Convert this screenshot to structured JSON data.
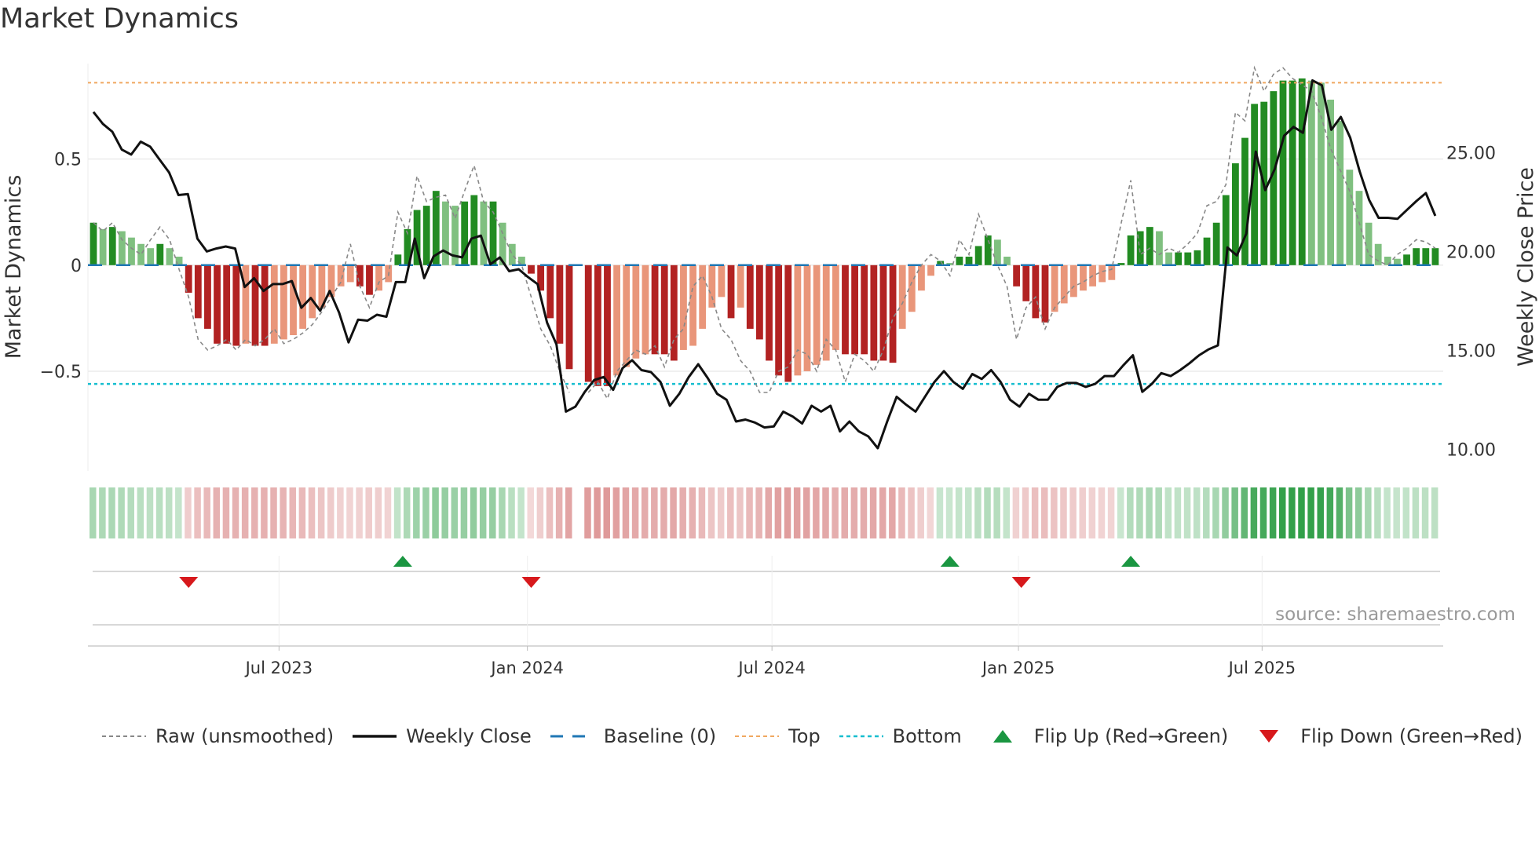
{
  "title": "Market Dynamics",
  "source": "source: sharemaestro.com",
  "chart_data": {
    "type": "bar",
    "title": "Market Dynamics",
    "ylabel_left": "Market Dynamics",
    "ylabel_right": "Weekly Close Price",
    "left_ticks": [
      {
        "v": 0.5,
        "label": "0.5"
      },
      {
        "v": 0,
        "label": "0"
      },
      {
        "v": -0.5,
        "label": "−0.5"
      }
    ],
    "right_ticks": [
      {
        "v": 25,
        "label": "25.00"
      },
      {
        "v": 20,
        "label": "20.00"
      },
      {
        "v": 15,
        "label": "15.00"
      },
      {
        "v": 10,
        "label": "10.00"
      }
    ],
    "x_ticks": [
      {
        "week": 19.5,
        "label": "Jul 2023"
      },
      {
        "week": 45.6,
        "label": "Jan 2024"
      },
      {
        "week": 71.3,
        "label": "Jul 2024"
      },
      {
        "week": 97.2,
        "label": "Jan 2025"
      },
      {
        "week": 122.8,
        "label": "Jul 2025"
      }
    ],
    "left_ylim": [
      -0.97,
      0.95
    ],
    "right_ylim": [
      8.9,
      29.5
    ],
    "top_level": 0.86,
    "bottom_level": -0.56,
    "baseline": 0,
    "momentum": [
      0.2,
      0.17,
      0.18,
      0.16,
      0.13,
      0.1,
      0.08,
      0.1,
      0.08,
      0.04,
      -0.13,
      -0.25,
      -0.3,
      -0.37,
      -0.37,
      -0.38,
      -0.37,
      -0.38,
      -0.38,
      -0.37,
      -0.35,
      -0.33,
      -0.3,
      -0.25,
      -0.2,
      -0.15,
      -0.1,
      -0.08,
      -0.1,
      -0.14,
      -0.12,
      -0.08,
      0.05,
      0.17,
      0.26,
      0.28,
      0.35,
      0.3,
      0.28,
      0.3,
      0.33,
      0.3,
      0.3,
      0.2,
      0.1,
      0.04,
      -0.04,
      -0.12,
      -0.25,
      -0.37,
      -0.49,
      null,
      -0.55,
      -0.57,
      -0.57,
      -0.52,
      -0.48,
      -0.44,
      -0.42,
      -0.42,
      -0.42,
      -0.45,
      -0.4,
      -0.38,
      -0.3,
      -0.2,
      -0.15,
      -0.25,
      -0.2,
      -0.3,
      -0.35,
      -0.45,
      -0.52,
      -0.55,
      -0.52,
      -0.5,
      -0.47,
      -0.45,
      -0.4,
      -0.42,
      -0.42,
      -0.42,
      -0.45,
      -0.45,
      -0.46,
      -0.3,
      -0.22,
      -0.12,
      -0.05,
      0.02,
      0.01,
      0.04,
      0.04,
      0.09,
      0.14,
      0.12,
      0.04,
      -0.1,
      -0.17,
      -0.25,
      -0.27,
      -0.22,
      -0.18,
      -0.15,
      -0.12,
      -0.1,
      -0.08,
      -0.07,
      0.01,
      0.14,
      0.16,
      0.18,
      0.16,
      0.06,
      0.06,
      0.06,
      0.07,
      0.13,
      0.2,
      0.33,
      0.48,
      0.6,
      0.76,
      0.77,
      0.82,
      0.87,
      0.87,
      0.88,
      0.87,
      0.86,
      0.78,
      0.68,
      0.45,
      0.35,
      0.2,
      0.1,
      0.04,
      0.03,
      0.05,
      0.08,
      0.08,
      0.08
    ],
    "raw": [
      0.2,
      0.16,
      0.2,
      0.12,
      0.08,
      0.05,
      0.12,
      0.18,
      0.12,
      -0.02,
      -0.15,
      -0.35,
      -0.4,
      -0.38,
      -0.35,
      -0.4,
      -0.35,
      -0.38,
      -0.35,
      -0.3,
      -0.37,
      -0.35,
      -0.32,
      -0.28,
      -0.22,
      -0.15,
      -0.08,
      0.1,
      -0.1,
      -0.2,
      -0.08,
      -0.05,
      0.25,
      0.15,
      0.42,
      0.3,
      0.32,
      0.33,
      0.22,
      0.35,
      0.47,
      0.3,
      0.25,
      0.15,
      0.05,
      0.0,
      -0.15,
      -0.3,
      -0.38,
      -0.5,
      -0.6,
      null,
      -0.6,
      -0.55,
      -0.63,
      -0.5,
      -0.45,
      -0.4,
      -0.42,
      -0.38,
      -0.48,
      -0.35,
      -0.3,
      -0.1,
      -0.05,
      -0.15,
      -0.3,
      -0.35,
      -0.45,
      -0.5,
      -0.6,
      -0.6,
      -0.5,
      -0.48,
      -0.4,
      -0.42,
      -0.5,
      -0.35,
      -0.4,
      -0.55,
      -0.42,
      -0.45,
      -0.5,
      -0.4,
      -0.25,
      -0.18,
      -0.08,
      0.0,
      0.05,
      0.02,
      -0.05,
      0.12,
      0.05,
      0.24,
      0.12,
      0.0,
      -0.1,
      -0.35,
      -0.2,
      -0.15,
      -0.3,
      -0.2,
      -0.15,
      -0.1,
      -0.08,
      -0.05,
      -0.03,
      -0.02,
      0.2,
      0.4,
      0.05,
      0.08,
      0.05,
      0.08,
      0.06,
      0.1,
      0.15,
      0.28,
      0.3,
      0.38,
      0.72,
      0.68,
      0.93,
      0.82,
      0.9,
      0.93,
      0.88,
      0.85,
      0.82,
      0.7,
      0.55,
      0.45,
      0.35,
      0.2,
      0.05,
      0.02,
      0.0,
      0.05,
      0.08,
      0.12,
      0.11,
      0.08
    ],
    "weekly_close": [
      27.05,
      26.45,
      26.05,
      25.15,
      24.9,
      25.55,
      25.3,
      24.65,
      24.0,
      22.85,
      22.9,
      20.65,
      20.0,
      20.15,
      20.25,
      20.15,
      18.2,
      18.65,
      18.0,
      18.35,
      18.35,
      18.5,
      17.15,
      17.65,
      17.0,
      18.0,
      16.9,
      15.4,
      16.55,
      16.5,
      16.8,
      16.7,
      18.45,
      18.45,
      20.65,
      18.65,
      19.75,
      20.05,
      19.8,
      19.7,
      20.65,
      20.8,
      19.35,
      19.7,
      19.0,
      19.1,
      18.7,
      18.35,
      16.4,
      15.3,
      11.9,
      12.15,
      12.9,
      13.5,
      13.65,
      13.0,
      14.1,
      14.5,
      14.0,
      13.9,
      13.4,
      12.2,
      12.8,
      13.65,
      14.3,
      13.6,
      12.8,
      12.5,
      11.4,
      11.5,
      11.35,
      11.1,
      11.15,
      11.9,
      11.65,
      11.3,
      12.2,
      11.9,
      12.2,
      10.9,
      11.4,
      10.9,
      10.65,
      10.05,
      11.4,
      12.65,
      12.25,
      11.9,
      12.65,
      13.4,
      13.95,
      13.4,
      13.05,
      13.8,
      13.55,
      14.0,
      13.4,
      12.5,
      12.15,
      12.8,
      12.5,
      12.5,
      13.15,
      13.35,
      13.35,
      13.15,
      13.3,
      13.7,
      13.7,
      14.25,
      14.75,
      12.9,
      13.3,
      13.85,
      13.7,
      14.0,
      14.35,
      14.75,
      15.05,
      15.25,
      20.2,
      19.8,
      20.9,
      25.05,
      23.1,
      24.15,
      25.85,
      26.3,
      26.0,
      28.65,
      28.4,
      26.15,
      26.8,
      25.75,
      24.05,
      22.6,
      21.7,
      21.7,
      21.65,
      22.1,
      22.55,
      22.95,
      21.8
    ],
    "flip_up_weeks": [
      32.5,
      90,
      109
    ],
    "flip_down_weeks": [
      10,
      46,
      97.5
    ],
    "colors": {
      "strong_green": "#228b22",
      "weak_green": "#80c080",
      "strong_red": "#b22222",
      "weak_red": "#e9967a",
      "price": "#111111",
      "raw": "#888888",
      "baseline": "#1f77b4",
      "top": "#f0a860",
      "bottom": "#17becf",
      "flip_up": "#1a9641",
      "flip_down": "#d7191c"
    },
    "legend": [
      {
        "key": "raw",
        "label": "Raw (unsmoothed)"
      },
      {
        "key": "price",
        "label": "Weekly Close"
      },
      {
        "key": "baseline",
        "label": "Baseline (0)"
      },
      {
        "key": "top",
        "label": "Top"
      },
      {
        "key": "bottom",
        "label": "Bottom"
      },
      {
        "key": "flip_up",
        "label": "Flip Up (Red→Green)"
      },
      {
        "key": "flip_down",
        "label": "Flip Down (Green→Red)"
      }
    ]
  }
}
